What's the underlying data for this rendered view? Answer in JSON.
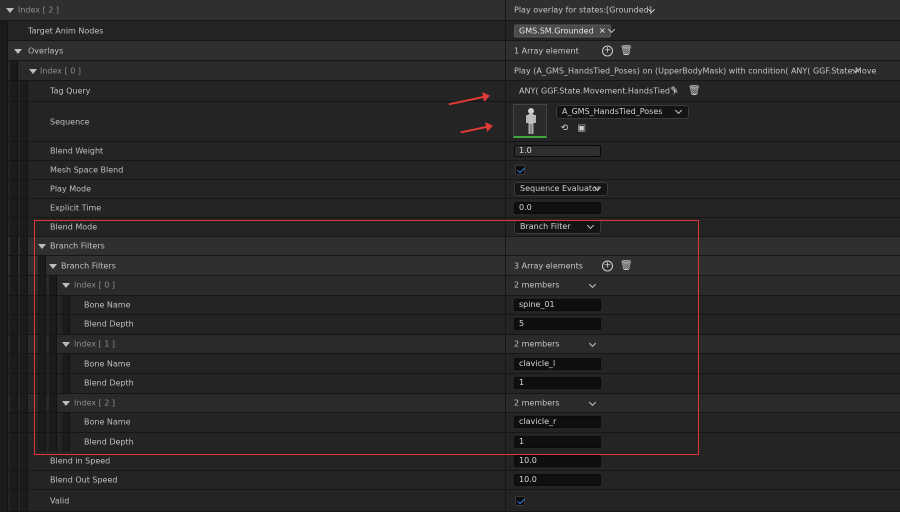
{
  "header": {
    "index_label": "Index [ 2 ]",
    "index_value": "Play overlay for states:[Grounded]"
  },
  "target_anim_nodes": {
    "label": "Target Anim Nodes",
    "tag": "GMS.SM.Grounded"
  },
  "overlays": {
    "label": "Overlays",
    "count": "1 Array element"
  },
  "overlay_index0": {
    "label": "Index [ 0 ]",
    "summary": "Play (A_GMS_HandsTied_Poses) on (UpperBodyMask) with condition( ANY( GGF.State.Move"
  },
  "tag_query": {
    "label": "Tag Query",
    "value": "ANY( GGF.State.Movement.HandsTied )"
  },
  "sequence": {
    "label": "Sequence",
    "asset": "A_GMS_HandsTied_Poses"
  },
  "blend_weight": {
    "label": "Blend Weight",
    "value": "1.0"
  },
  "mesh_space_blend": {
    "label": "Mesh Space Blend",
    "checked": true
  },
  "play_mode": {
    "label": "Play Mode",
    "value": "Sequence Evaluator"
  },
  "explicit_time": {
    "label": "Explicit Time",
    "value": "0.0"
  },
  "blend_mode": {
    "label": "Blend Mode",
    "value": "Branch Filter"
  },
  "branch_filters_group": {
    "label": "Branch Filters"
  },
  "branch_filters": {
    "label": "Branch Filters",
    "count": "3 Array elements",
    "items": [
      {
        "index_label": "Index [ 0 ]",
        "members": "2 members",
        "bone_label": "Bone Name",
        "bone": "spine_01",
        "depth_label": "Blend Depth",
        "depth": "5"
      },
      {
        "index_label": "Index [ 1 ]",
        "members": "2 members",
        "bone_label": "Bone Name",
        "bone": "clavicle_l",
        "depth_label": "Blend Depth",
        "depth": "1"
      },
      {
        "index_label": "Index [ 2 ]",
        "members": "2 members",
        "bone_label": "Bone Name",
        "bone": "clavicle_r",
        "depth_label": "Blend Depth",
        "depth": "1"
      }
    ]
  },
  "blend_in_speed": {
    "label": "Blend in Speed",
    "value": "10.0"
  },
  "blend_out_speed": {
    "label": "Blend Out Speed",
    "value": "10.0"
  },
  "valid": {
    "label": "Valid",
    "checked": true
  },
  "icons": {
    "add": "plus-circle-icon",
    "delete": "trash-icon",
    "edit": "pencil-icon",
    "reset": "reset-arrow-icon",
    "browse": "browse-folder-icon",
    "expand": "chevron-down-icon"
  },
  "colors": {
    "highlight_box": "#e0333a",
    "check_accent": "#2d7fe6",
    "thumb_underline": "#3fa73f"
  }
}
